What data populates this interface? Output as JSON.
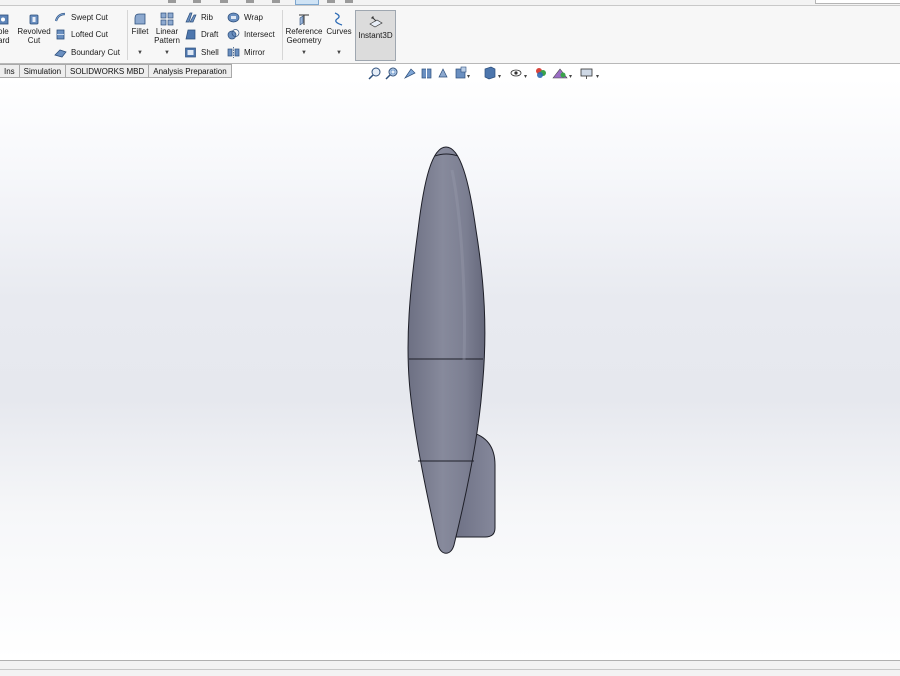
{
  "ribbon": {
    "cut_group": {
      "partial_label_line1": "ole",
      "partial_label_line2": "ard",
      "revolved_cut_line1": "Revolved",
      "revolved_cut_line2": "Cut",
      "swept_cut": "Swept Cut",
      "lofted_cut": "Lofted Cut",
      "boundary_cut": "Boundary Cut"
    },
    "features_group": {
      "fillet": "Fillet",
      "linear_pattern_line1": "Linear",
      "linear_pattern_line2": "Pattern",
      "rib": "Rib",
      "draft": "Draft",
      "shell": "Shell",
      "wrap": "Wrap",
      "intersect": "Intersect",
      "mirror": "Mirror"
    },
    "geometry_group": {
      "reference_geometry_line1": "Reference",
      "reference_geometry_line2": "Geometry",
      "curves": "Curves",
      "instant3d": "Instant3D"
    }
  },
  "tabs": [
    {
      "label": "Ins"
    },
    {
      "label": "Simulation"
    },
    {
      "label": "SOLIDWORKS MBD"
    },
    {
      "label": "Analysis Preparation"
    }
  ],
  "view_toolbar": {
    "icons": [
      "zoom-to-fit-icon",
      "zoom-to-area-icon",
      "previous-view-icon",
      "section-view-icon",
      "dynamic-annotation-icon",
      "view-orientation-icon",
      "display-style-icon",
      "hide-show-items-icon",
      "edit-appearance-icon",
      "apply-scene-icon",
      "view-settings-icon"
    ]
  },
  "colors": {
    "model_body": "#7f8294",
    "model_shadow": "#5d6072",
    "viewport_mid": "#e6e8ee",
    "selected_button": "#dcdcdc"
  }
}
